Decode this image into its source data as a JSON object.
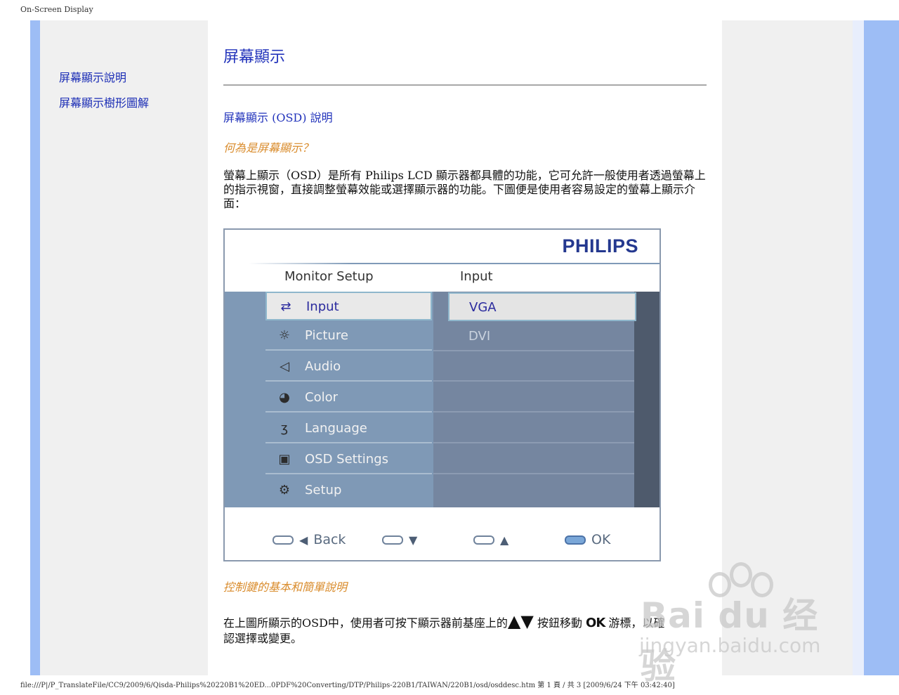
{
  "browser": {
    "header_title": "On-Screen Display",
    "footer_path": "file:///P|/P_TranslateFile/CC9/2009/6/Qisda-Philips%20220B1%20ED...0PDF%20Converting/DTP/Philips-220B1/TAIWAN/220B1/osd/osddesc.htm 第 1 頁 / 共 3 [2009/6/24 下午 03:42:40]"
  },
  "sidebar": {
    "links": [
      "屏幕顯示說明",
      "屏幕顯示樹形圖解"
    ]
  },
  "main": {
    "title": "屏幕顯示",
    "subtitle": "屏幕顯示 (OSD) 說明",
    "q1": "何為是屏幕顯示？",
    "para1": "螢幕上顯示（OSD）是所有 Philips LCD 顯示器都具體的功能，它可允許一般使用者透過螢幕上的指示視窗，直接調整螢幕效能或選擇顯示器的功能。下圖便是使用者容易設定的螢幕上顯示介面：",
    "q2": "控制鍵的基本和簡單說明",
    "para2_a": "在上圖所顯示的OSD中，使用者可按下顯示器前基座上的",
    "para2_arrows": "▲▼",
    "para2_b": "按鈕移動",
    "para2_ok": "OK",
    "para2_c": "游標，以確",
    "para2_d": "認選擇或變更。"
  },
  "osd": {
    "brand": "PHILIPS",
    "menu_title": "Monitor Setup",
    "submenu_title": "Input",
    "menu_items": [
      {
        "label": "Input",
        "icon": "input-arrows-icon"
      },
      {
        "label": "Picture",
        "icon": "sun-icon"
      },
      {
        "label": "Audio",
        "icon": "speaker-icon"
      },
      {
        "label": "Color",
        "icon": "palette-icon"
      },
      {
        "label": "Language",
        "icon": "speech-icon"
      },
      {
        "label": "OSD Settings",
        "icon": "screen-icon"
      },
      {
        "label": "Setup",
        "icon": "gear-icon"
      }
    ],
    "options": [
      "VGA",
      "DVI"
    ],
    "buttons": {
      "back": "Back",
      "down": "▼",
      "up": "▲",
      "ok": "OK"
    }
  },
  "watermark": {
    "brand": "Bai du 经验",
    "url": "jingyan.baidu.com"
  }
}
